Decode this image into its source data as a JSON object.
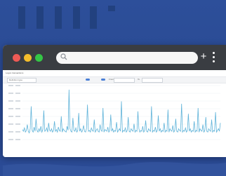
{
  "browser": {
    "url": "",
    "new_tab_symbol": "+"
  },
  "page": {
    "heading": "Logon transactions",
    "selector_value": "Definition type",
    "from_label": "From",
    "to_label": "To",
    "footer": ""
  },
  "colors": {
    "background": "#2b4b96",
    "titlebar": "#3a3d42",
    "close": "#ee5a55",
    "minimize": "#f4bd2c",
    "maximize": "#35c646",
    "series": "#5fb3d9"
  },
  "chart_data": {
    "type": "line",
    "series": [
      {
        "values": [
          32,
          30,
          34,
          29,
          31,
          38,
          30,
          28,
          33,
          60,
          31,
          29,
          35,
          30,
          45,
          31,
          29,
          33,
          30,
          36,
          29,
          32,
          55,
          30,
          31,
          34,
          29,
          40,
          31,
          30,
          33,
          29,
          31,
          42,
          30,
          32,
          29,
          35,
          31,
          30,
          48,
          29,
          33,
          31,
          30,
          29,
          36,
          31,
          80,
          33,
          30,
          29,
          46,
          31,
          30,
          34,
          29,
          31,
          52,
          30,
          33,
          29,
          31,
          37,
          30,
          29,
          33,
          62,
          30,
          31,
          29,
          34,
          31,
          30,
          44,
          29,
          31,
          33,
          30,
          29,
          38,
          31,
          30,
          58,
          29,
          32,
          31,
          30,
          35,
          29,
          31,
          50,
          30,
          33,
          29,
          31,
          30,
          41,
          29,
          31,
          33,
          30,
          66,
          29,
          31,
          30,
          34,
          29,
          31,
          47,
          30,
          29,
          33,
          31,
          30,
          39,
          29,
          31,
          30,
          54,
          33,
          29,
          31,
          30,
          36,
          29,
          31,
          43,
          30,
          29,
          33,
          31,
          30,
          60,
          29,
          31,
          30,
          35,
          29,
          31,
          49,
          30,
          33,
          29,
          31,
          30,
          40,
          29,
          31,
          30,
          56,
          29,
          33,
          31,
          30,
          37,
          29,
          31,
          45,
          30,
          29,
          33,
          31,
          30,
          63,
          29,
          31,
          30,
          34,
          29,
          31,
          51,
          30,
          33,
          29,
          31,
          30,
          42,
          29,
          31,
          30,
          58,
          29,
          33,
          31,
          30,
          38,
          29,
          31,
          47,
          30,
          29,
          33,
          31,
          30,
          44,
          29,
          31,
          30,
          53,
          29,
          31,
          33,
          30,
          40
        ]
      }
    ]
  }
}
